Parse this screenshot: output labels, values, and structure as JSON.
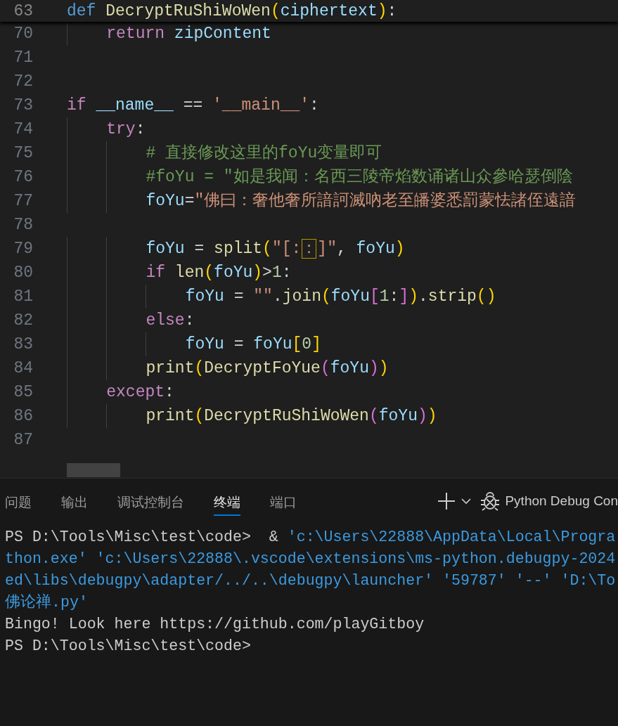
{
  "editor": {
    "sticky_line": {
      "number": "63",
      "tokens": [
        {
          "kind": "def",
          "text": "def"
        },
        {
          "kind": "fn",
          "text": " DecryptRuShiWoWen"
        },
        {
          "kind": "b1",
          "text": "("
        },
        {
          "kind": "var",
          "text": "ciphertext"
        },
        {
          "kind": "b1",
          "text": ")"
        },
        {
          "kind": "op",
          "text": ":"
        }
      ]
    },
    "lines": [
      {
        "number": "70",
        "tokens": [
          {
            "kind": "kw",
            "text": "    return"
          },
          {
            "kind": "var",
            "text": " zipContent"
          }
        ]
      },
      {
        "number": "71"
      },
      {
        "number": "72"
      },
      {
        "number": "73",
        "tokens": [
          {
            "kind": "kw",
            "text": "if"
          },
          {
            "kind": "var",
            "text": " __name__"
          },
          {
            "kind": "op",
            "text": " == "
          },
          {
            "kind": "str",
            "text": "'__main__'"
          },
          {
            "kind": "op",
            "text": ":"
          }
        ]
      },
      {
        "number": "74",
        "tokens": [
          {
            "kind": "kw",
            "text": "    try"
          },
          {
            "kind": "op",
            "text": ":"
          }
        ]
      },
      {
        "number": "75",
        "tokens": [
          {
            "kind": "cmt",
            "text": "        # 直接修改这里的foYu变量即可"
          }
        ]
      },
      {
        "number": "76",
        "tokens": [
          {
            "kind": "cmt",
            "text": "        #foYu = \"如是我闻：名西三陵帝焰数诵诸山众參哈瑟倒陰"
          }
        ]
      },
      {
        "number": "77",
        "tokens": [
          {
            "kind": "var",
            "text": "        foYu"
          },
          {
            "kind": "op",
            "text": "="
          },
          {
            "kind": "str",
            "text": "\"佛曰：奢他奢所諳訶滅吶老至皤婆悉罰蒙怯諸侄遠諳"
          }
        ]
      },
      {
        "number": "78"
      },
      {
        "number": "79",
        "tokens": [
          {
            "kind": "var",
            "text": "        foYu"
          },
          {
            "kind": "op",
            "text": " = "
          },
          {
            "kind": "fn",
            "text": "split"
          },
          {
            "kind": "b1",
            "text": "("
          },
          {
            "kind": "str",
            "text": "\"[:"
          },
          {
            "kind": "hl",
            "text": "："
          },
          {
            "kind": "str",
            "text": "]\""
          },
          {
            "kind": "op",
            "text": ", "
          },
          {
            "kind": "var",
            "text": "foYu"
          },
          {
            "kind": "b1",
            "text": ")"
          }
        ]
      },
      {
        "number": "80",
        "tokens": [
          {
            "kind": "kw",
            "text": "        if"
          },
          {
            "kind": "fn",
            "text": " len"
          },
          {
            "kind": "b1",
            "text": "("
          },
          {
            "kind": "var",
            "text": "foYu"
          },
          {
            "kind": "b1",
            "text": ")"
          },
          {
            "kind": "op",
            "text": ">"
          },
          {
            "kind": "num",
            "text": "1"
          },
          {
            "kind": "op",
            "text": ":"
          }
        ]
      },
      {
        "number": "81",
        "tokens": [
          {
            "kind": "var",
            "text": "            foYu"
          },
          {
            "kind": "op",
            "text": " = "
          },
          {
            "kind": "str",
            "text": "\"\""
          },
          {
            "kind": "op",
            "text": "."
          },
          {
            "kind": "fn",
            "text": "join"
          },
          {
            "kind": "b1",
            "text": "("
          },
          {
            "kind": "var",
            "text": "foYu"
          },
          {
            "kind": "b2",
            "text": "["
          },
          {
            "kind": "num",
            "text": "1"
          },
          {
            "kind": "op",
            "text": ":"
          },
          {
            "kind": "b2",
            "text": "]"
          },
          {
            "kind": "b1",
            "text": ")"
          },
          {
            "kind": "op",
            "text": "."
          },
          {
            "kind": "fn",
            "text": "strip"
          },
          {
            "kind": "b1",
            "text": "()"
          }
        ]
      },
      {
        "number": "82",
        "tokens": [
          {
            "kind": "kw",
            "text": "        else"
          },
          {
            "kind": "op",
            "text": ":"
          }
        ]
      },
      {
        "number": "83",
        "tokens": [
          {
            "kind": "var",
            "text": "            foYu"
          },
          {
            "kind": "op",
            "text": " = "
          },
          {
            "kind": "var",
            "text": "foYu"
          },
          {
            "kind": "b1",
            "text": "["
          },
          {
            "kind": "num",
            "text": "0"
          },
          {
            "kind": "b1",
            "text": "]"
          }
        ]
      },
      {
        "number": "84",
        "tokens": [
          {
            "kind": "fn",
            "text": "        print"
          },
          {
            "kind": "b1",
            "text": "("
          },
          {
            "kind": "fn",
            "text": "DecryptFoYue"
          },
          {
            "kind": "b2",
            "text": "("
          },
          {
            "kind": "var",
            "text": "foYu"
          },
          {
            "kind": "b2",
            "text": ")"
          },
          {
            "kind": "b1",
            "text": ")"
          }
        ]
      },
      {
        "number": "85",
        "tokens": [
          {
            "kind": "kw",
            "text": "    except"
          },
          {
            "kind": "op",
            "text": ":"
          }
        ]
      },
      {
        "number": "86",
        "tokens": [
          {
            "kind": "fn",
            "text": "        print"
          },
          {
            "kind": "b1",
            "text": "("
          },
          {
            "kind": "fn",
            "text": "DecryptRuShiWoWen"
          },
          {
            "kind": "b2",
            "text": "("
          },
          {
            "kind": "var",
            "text": "foYu"
          },
          {
            "kind": "b2",
            "text": ")"
          },
          {
            "kind": "b1",
            "text": ")"
          }
        ]
      },
      {
        "number": "87"
      }
    ]
  },
  "panel": {
    "tabs": [
      {
        "label": "问题",
        "selected": false
      },
      {
        "label": "输出",
        "selected": false
      },
      {
        "label": "调试控制台",
        "selected": false
      },
      {
        "label": "终端",
        "selected": true
      },
      {
        "label": "端口",
        "selected": false
      }
    ],
    "terminal_name": "Python Debug Con",
    "terminal_lines": [
      [
        {
          "kind": "plain",
          "text": "PS D:\\Tools\\Misc\\test\\code>  & "
        },
        {
          "kind": "path",
          "text": "'c:\\Users\\22888\\AppData\\Local\\Progra"
        }
      ],
      [
        {
          "kind": "path",
          "text": "thon.exe' 'c:\\Users\\22888\\.vscode\\extensions\\ms-python.debugpy-2024"
        }
      ],
      [
        {
          "kind": "path",
          "text": "ed\\libs\\debugpy\\adapter/../..\\debugpy\\launcher' '59787' '--' 'D:\\To"
        }
      ],
      [
        {
          "kind": "path",
          "text": "佛论禅.py'"
        }
      ],
      [
        {
          "kind": "plain",
          "text": "Bingo! Look here https://github.com/playGitboy"
        }
      ],
      [
        {
          "kind": "plain",
          "text": "PS D:\\Tools\\Misc\\test\\code>"
        }
      ]
    ]
  }
}
